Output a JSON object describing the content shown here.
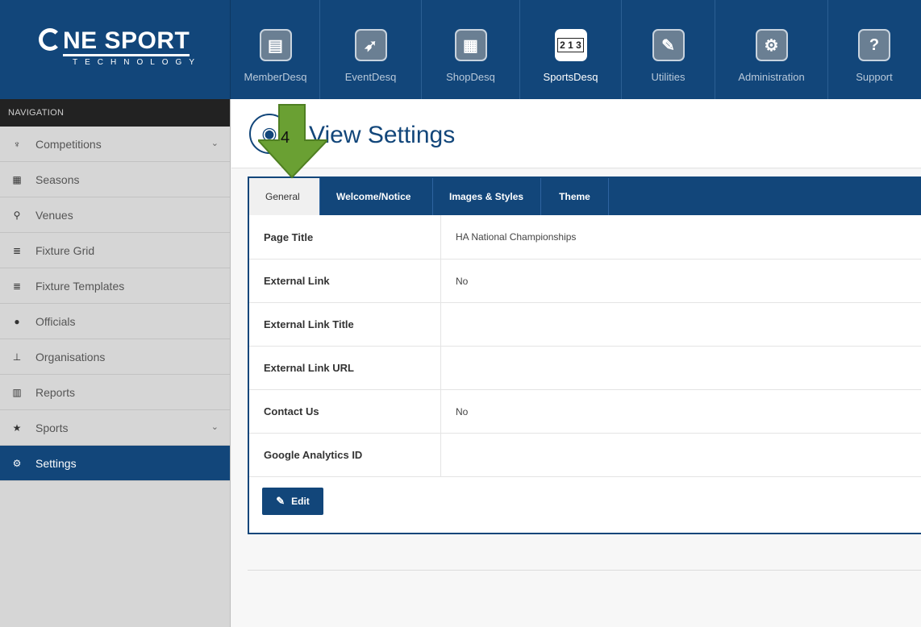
{
  "brand": {
    "name": "NE SPORT",
    "subtitle": "TECHNOLOGY"
  },
  "modules": [
    {
      "label": "MemberDesq",
      "icon": "document-icon",
      "glyph": "▤",
      "active": false
    },
    {
      "label": "EventDesq",
      "icon": "runner-icon",
      "glyph": "🏃",
      "active": false
    },
    {
      "label": "ShopDesq",
      "icon": "cart-icon",
      "glyph": "🛒",
      "active": false
    },
    {
      "label": "SportsDesq",
      "icon": "podium-icon",
      "glyph": "²¹³",
      "active": true
    },
    {
      "label": "Utilities",
      "icon": "wrench-icon",
      "glyph": "🔧",
      "active": false
    },
    {
      "label": "Administration",
      "icon": "gear-icon",
      "glyph": "⚙",
      "active": false
    },
    {
      "label": "Support",
      "icon": "help-icon",
      "glyph": "?",
      "active": false
    }
  ],
  "nav": {
    "heading": "NAVIGATION",
    "items": [
      {
        "label": "Competitions",
        "icon": "trophy-icon",
        "glyph": "🏆",
        "chevron": true
      },
      {
        "label": "Seasons",
        "icon": "calendar-icon",
        "glyph": "▦",
        "chevron": false
      },
      {
        "label": "Venues",
        "icon": "map-marker-icon",
        "glyph": "⚲",
        "chevron": false
      },
      {
        "label": "Fixture Grid",
        "icon": "list-icon",
        "glyph": "≣",
        "chevron": false
      },
      {
        "label": "Fixture Templates",
        "icon": "list-icon",
        "glyph": "≣",
        "chevron": false
      },
      {
        "label": "Officials",
        "icon": "user-icon",
        "glyph": "●",
        "chevron": false
      },
      {
        "label": "Organisations",
        "icon": "sitemap-icon",
        "glyph": "⊥",
        "chevron": false
      },
      {
        "label": "Reports",
        "icon": "bar-chart-icon",
        "glyph": "▥",
        "chevron": false
      },
      {
        "label": "Sports",
        "icon": "star-icon",
        "glyph": "★",
        "chevron": true
      },
      {
        "label": "Settings",
        "icon": "cogs-icon",
        "glyph": "⚙",
        "chevron": false,
        "active": true
      }
    ],
    "chevron_glyph": "⌄"
  },
  "page": {
    "title": "View Settings"
  },
  "tabs": [
    {
      "label": "General",
      "active": true
    },
    {
      "label": "Welcome/Notice",
      "active": false
    },
    {
      "label": "Images & Styles",
      "active": false
    },
    {
      "label": "Theme",
      "active": false
    }
  ],
  "settings": [
    {
      "label": "Page Title",
      "value": "HA National Championships"
    },
    {
      "label": "External Link",
      "value": "No"
    },
    {
      "label": "External Link Title",
      "value": ""
    },
    {
      "label": "External Link URL",
      "value": ""
    },
    {
      "label": "Contact Us",
      "value": "No"
    },
    {
      "label": "Google Analytics ID",
      "value": ""
    }
  ],
  "edit_button": {
    "label": "Edit",
    "icon": "edit-icon"
  },
  "annotation": {
    "number": "4",
    "color": "#6aa033"
  },
  "colors": {
    "brand": "#12467a",
    "sidebar": "#d6d6d6",
    "nav_header": "#222222"
  }
}
